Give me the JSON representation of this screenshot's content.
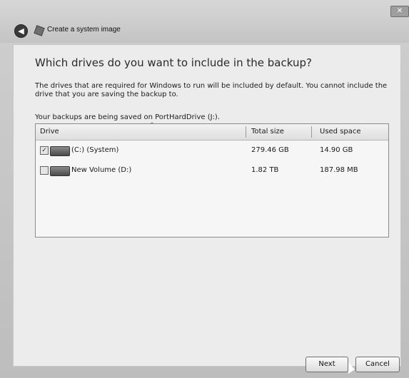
{
  "window": {
    "title": "Create a system image",
    "close_label": "✕"
  },
  "icons": {
    "back": "back-arrow-icon",
    "app": "system-image-icon",
    "drive": "hard-drive-icon",
    "sort": "sort-asc-icon"
  },
  "main": {
    "heading": "Which drives do you want to include in the backup?",
    "description": "The drives that are required for Windows to run will be included by default. You cannot include the drive that you are saving the backup to.",
    "saving_to": "Your backups are being saved on PortHardDrive (J:).",
    "table": {
      "columns": [
        "Drive",
        "Total size",
        "Used space"
      ],
      "rows": [
        {
          "checked": true,
          "name": "(C:) (System)",
          "total": "279.46 GB",
          "used": "14.90 GB"
        },
        {
          "checked": false,
          "name": "New Volume (D:)",
          "total": "1.82 TB",
          "used": "187.98 MB"
        }
      ]
    }
  },
  "buttons": {
    "next": "Next",
    "cancel": "Cancel"
  }
}
